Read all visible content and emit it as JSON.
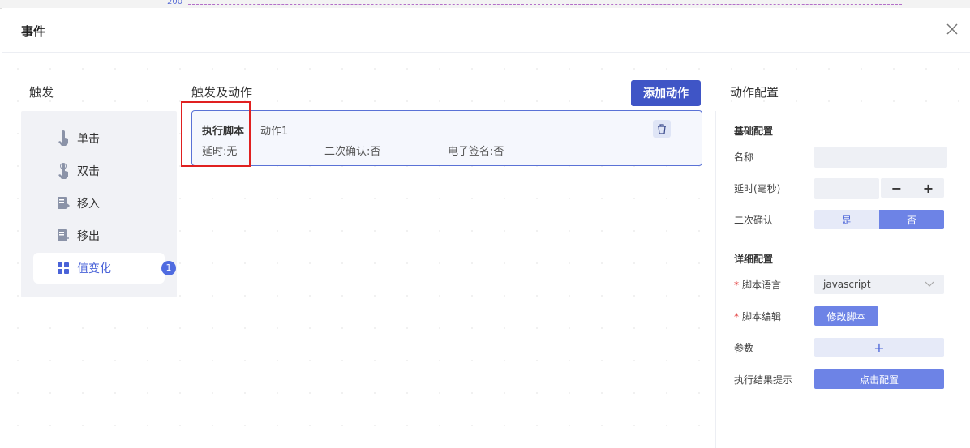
{
  "backdrop": {
    "axis_number": "200"
  },
  "dialog": {
    "title": "事件",
    "close_icon": "close-icon"
  },
  "sections": {
    "trigger": "触发",
    "trigger_actions": "触发及动作",
    "action_config": "动作配置"
  },
  "triggers": [
    {
      "label": "单击",
      "icon": "tap-icon"
    },
    {
      "label": "双击",
      "icon": "double-tap-icon"
    },
    {
      "label": "移入",
      "icon": "move-in-icon"
    },
    {
      "label": "移出",
      "icon": "move-out-icon"
    },
    {
      "label": "值变化",
      "icon": "grid-icon",
      "badge": "1",
      "active": true
    }
  ],
  "add_action_label": "添加动作",
  "action_card": {
    "type": "执行脚本",
    "name": "动作1",
    "delay": "延时:无",
    "confirm": "二次确认:否",
    "signature": "电子签名:否"
  },
  "config": {
    "basic_group": "基础配置",
    "name_label": "名称",
    "name_value": "",
    "delay_label": "延时(毫秒)",
    "delay_value": "",
    "stepper_minus": "−",
    "stepper_plus": "+",
    "confirm_label": "二次确认",
    "confirm_yes": "是",
    "confirm_no": "否",
    "detail_group": "详细配置",
    "script_lang_label": "脚本语言",
    "script_lang_value": "javascript",
    "script_edit_label": "脚本编辑",
    "script_edit_button": "修改脚本",
    "params_label": "参数",
    "params_add": "+",
    "result_label": "执行结果提示",
    "result_button": "点击配置",
    "required_mark": "*"
  },
  "colors": {
    "accent": "#3f55c6",
    "accent_light": "#6d83e6",
    "highlight": "#e02020"
  }
}
